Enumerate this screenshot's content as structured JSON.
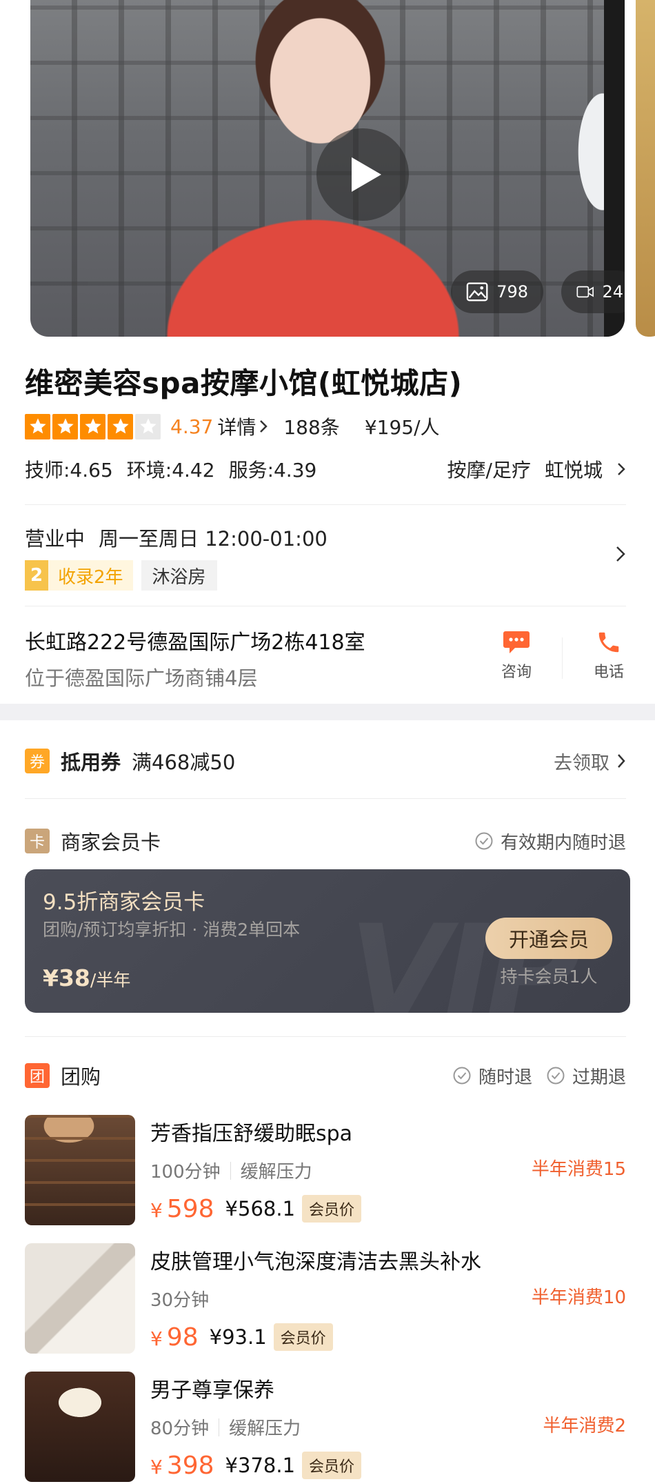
{
  "media": {
    "photo_count": "798",
    "video_count": "24"
  },
  "shop": {
    "name": "维密美容spa按摩小馆(虹悦城店)",
    "rating": {
      "stars_filled": 4,
      "stars_total": 5,
      "score": "4.37",
      "details_label": "详情",
      "reviews": "188条",
      "price_per_person": "¥195/人"
    },
    "subscores": [
      "技师:4.65",
      "环境:4.42",
      "服务:4.39"
    ],
    "categories": [
      "按摩/足疗",
      "虹悦城"
    ],
    "status": "营业中",
    "hours": "周一至周日 12:00-01:00",
    "tags": {
      "years_num": "2",
      "years_text": "收录2年",
      "facility": "沐浴房"
    },
    "address_line1": "长虹路222号德盈国际广场2栋418室",
    "address_line2": "位于德盈国际广场商铺4层",
    "actions": {
      "consult": "咨询",
      "phone": "电话"
    }
  },
  "coupon": {
    "icon": "券",
    "label": "抵用券",
    "desc": "满468减50",
    "action": "去领取"
  },
  "member_card": {
    "icon": "卡",
    "label": "商家会员卡",
    "refund_note": "有效期内随时退",
    "card_title": "9.5折商家会员卡",
    "card_sub": "团购/预订均享折扣 · 消费2单回本",
    "price": "¥38",
    "period": "/半年",
    "button": "开通会员",
    "holders": "持卡会员1人"
  },
  "group_buy": {
    "icon": "团",
    "label": "团购",
    "policies": [
      "随时退",
      "过期退"
    ],
    "deals": [
      {
        "name": "芳香指压舒缓助眠spa",
        "duration": "100分钟",
        "tag": "缓解压力",
        "sales": "半年消费15",
        "price": "598",
        "member_price": "¥568.1",
        "member_tag": "会员价"
      },
      {
        "name": "皮肤管理小气泡深度清洁去黑头补水",
        "duration": "30分钟",
        "tag": "",
        "sales": "半年消费10",
        "price": "98",
        "member_price": "¥93.1",
        "member_tag": "会员价"
      },
      {
        "name": "男子尊享保养",
        "duration": "80分钟",
        "tag": "缓解压力",
        "sales": "半年消费2",
        "price": "398",
        "member_price": "¥378.1",
        "member_tag": "会员价"
      }
    ]
  },
  "colors": {
    "accent_orange": "#ff6633",
    "star": "#fe8c00",
    "vip_card_bg": "#41434d"
  }
}
